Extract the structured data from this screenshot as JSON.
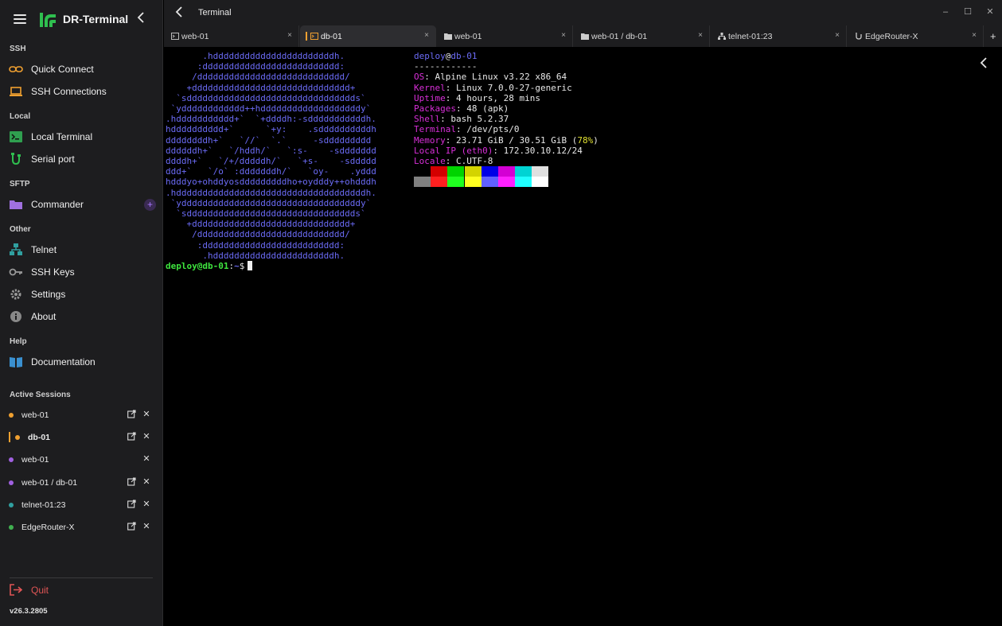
{
  "app": {
    "name": "DR-Terminal",
    "version": "v26.3.2805"
  },
  "sidebar": {
    "sections": {
      "ssh": "SSH",
      "local": "Local",
      "sftp": "SFTP",
      "other": "Other",
      "help": "Help",
      "active": "Active Sessions"
    },
    "items": {
      "quick_connect": "Quick Connect",
      "ssh_connections": "SSH Connections",
      "local_terminal": "Local Terminal",
      "serial_port": "Serial port",
      "commander": "Commander",
      "telnet": "Telnet",
      "ssh_keys": "SSH Keys",
      "settings": "Settings",
      "about": "About",
      "documentation": "Documentation"
    },
    "commander_add": "+",
    "sessions": [
      {
        "label": "web-01",
        "color": "#f0a030",
        "popout": true
      },
      {
        "label": "db-01",
        "color": "#f0a030",
        "popout": true,
        "active": true
      },
      {
        "label": "web-01",
        "color": "#a060e0",
        "popout": false
      },
      {
        "label": "web-01 / db-01",
        "color": "#a060e0",
        "popout": true
      },
      {
        "label": "telnet-01:23",
        "color": "#30a0a0",
        "popout": true
      },
      {
        "label": "EdgeRouter-X",
        "color": "#40b050",
        "popout": true
      }
    ],
    "quit": "Quit"
  },
  "titlebar": {
    "title": "Terminal",
    "minimize": "–",
    "maximize": "☐",
    "close": "✕"
  },
  "tabs": [
    {
      "label": "web-01",
      "icon": "terminal-icon"
    },
    {
      "label": "db-01",
      "icon": "terminal-icon",
      "active": true
    },
    {
      "label": "web-01",
      "icon": "folder-icon"
    },
    {
      "label": "web-01 / db-01",
      "icon": "folder-icon"
    },
    {
      "label": "telnet-01:23",
      "icon": "network-icon"
    },
    {
      "label": "EdgeRouter-X",
      "icon": "serial-icon"
    }
  ],
  "tab_close": "×",
  "new_tab": "+",
  "terminal": {
    "ascii_art": [
      "       .hdddddddddddddddddddddddh.",
      "      :dddddddddddddddddddddddddd:",
      "     /dddddddddddddddddddddddddddd/",
      "    +dddddddddddddddddddddddddddddd+",
      "  `sdddddddddddddddddddddddddddddddds`",
      " `ydddddddddddd++hdddddddddddddddddddy`",
      ".hddddddddddd+`  `+ddddh:-sdddddddddddh.",
      "hdddddddddd+`      `+y:    .sddddddddddh",
      "ddddddddh+`   `//`  `.`     -sddddddddd",
      "ddddddh+`   `/hddh/`   `:s-    -sddddddd",
      "ddddh+`   `/+/dddddh/`   `+s-    -sddddd",
      "ddd+`   `/o` :dddddddh/`   `oy-    .yddd",
      "hdddyo+ohddyosdddddddddho+oydddy++ohdddh",
      ".hddddddddddddddddddddddddddddddddddddh.",
      " `yddddddddddddddddddddddddddddddddddy`",
      "  `sdddddddddddddddddddddddddddddddds`",
      "    +dddddddddddddddddddddddddddddd+",
      "     /dddddddddddddddddddddddddddd/",
      "      :dddddddddddddddddddddddddd:",
      "       .hdddddddddddddddddddddddh."
    ],
    "user": "deploy",
    "host": "db-01",
    "separator": "------------",
    "fields": {
      "os_key": "OS",
      "os_val": "Alpine Linux v3.22 x86_64",
      "kernel_key": "Kernel",
      "kernel_val": "Linux 7.0.0-27-generic",
      "uptime_key": "Uptime",
      "uptime_val": "4 hours, 28 mins",
      "packages_key": "Packages",
      "packages_val": "48 (apk)",
      "shell_key": "Shell",
      "shell_val": "bash 5.2.37",
      "terminal_key": "Terminal",
      "terminal_val": "/dev/pts/0",
      "memory_key": "Memory",
      "memory_val": "23.71 GiB / 30.51 GiB (",
      "memory_pct": "78%",
      "memory_close": ")",
      "ip_key": "Local IP (eth0)",
      "ip_val": "172.30.10.12/24",
      "locale_key": "Locale",
      "locale_val": "C.UTF-8"
    },
    "palette_row1": [
      "#000000",
      "#d40000",
      "#00d400",
      "#d4d400",
      "#0000e6",
      "#d400d4",
      "#00d4d4",
      "#e0e0e0"
    ],
    "palette_row2": [
      "#808080",
      "#ff2020",
      "#20ff20",
      "#ffff20",
      "#6060ff",
      "#ff20ff",
      "#20ffff",
      "#ffffff"
    ],
    "prompt_user_host": "deploy@db-01",
    "prompt_path": "~",
    "prompt_symbol": "$"
  }
}
